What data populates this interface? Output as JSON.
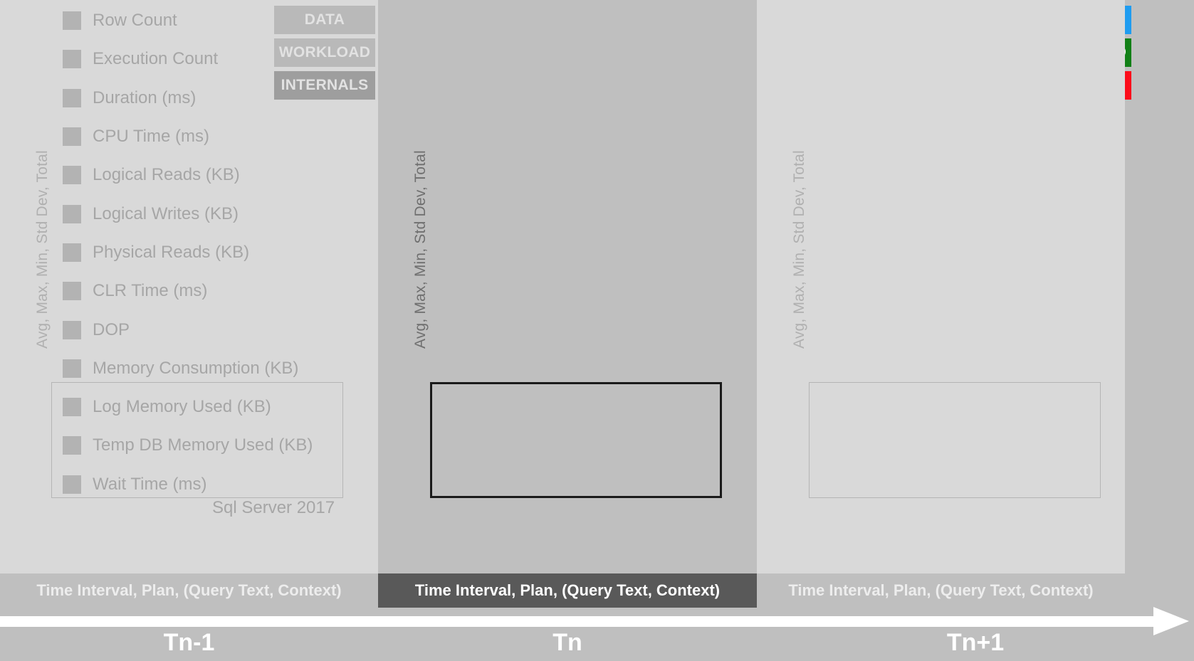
{
  "diagram": {
    "axis_label": "Avg, Max, Min, Std Dev, Total",
    "card_caption": "Sql Server 2017",
    "dimension_band": "Time Interval, Plan, (Query Text, Context)"
  },
  "colors": {
    "data": "#1f9cf0",
    "workload": "#128017",
    "internals": "#fc0d1b",
    "dim_swatch": "#b3b3b3",
    "dim_text": "#a6a6a6",
    "active_text": "#111111",
    "panel_inactive_bg": "#d9d9d9",
    "panel_active_bg": "#bfbfbf",
    "band_inactive_bg": "#bfbfbf",
    "band_active_bg": "#595959",
    "timeline_arrow": "#ffffff"
  },
  "metrics": [
    {
      "label": "Row Count",
      "category": "data"
    },
    {
      "label": "Execution Count",
      "category": "workload"
    },
    {
      "label": "Duration (ms)",
      "category": "workload"
    },
    {
      "label": "CPU Time (ms)",
      "category": "internals"
    },
    {
      "label": "Logical Reads (KB)",
      "category": "internals"
    },
    {
      "label": "Logical Writes (KB)",
      "category": "internals"
    },
    {
      "label": "Physical Reads (KB)",
      "category": "internals"
    },
    {
      "label": "CLR Time (ms)",
      "category": "internals"
    },
    {
      "label": "DOP",
      "category": "internals"
    },
    {
      "label": "Memory Consumption (KB)",
      "category": "internals"
    },
    {
      "label": "Log Memory Used (KB)",
      "category": "internals"
    },
    {
      "label": "Temp DB Memory Used (KB)",
      "category": "internals"
    },
    {
      "label": "Wait Time (ms)",
      "category": "internals"
    }
  ],
  "chips": [
    {
      "label": "DATA",
      "category": "data"
    },
    {
      "label": "WORKLOAD",
      "category": "workload"
    },
    {
      "label": "INTERNALS",
      "category": "internals"
    }
  ],
  "panels": [
    {
      "id": "prev",
      "tick": "Tn-1",
      "state": "inactive"
    },
    {
      "id": "curr",
      "tick": "Tn",
      "state": "active"
    },
    {
      "id": "next",
      "tick": "Tn+1",
      "state": "inactive"
    }
  ]
}
